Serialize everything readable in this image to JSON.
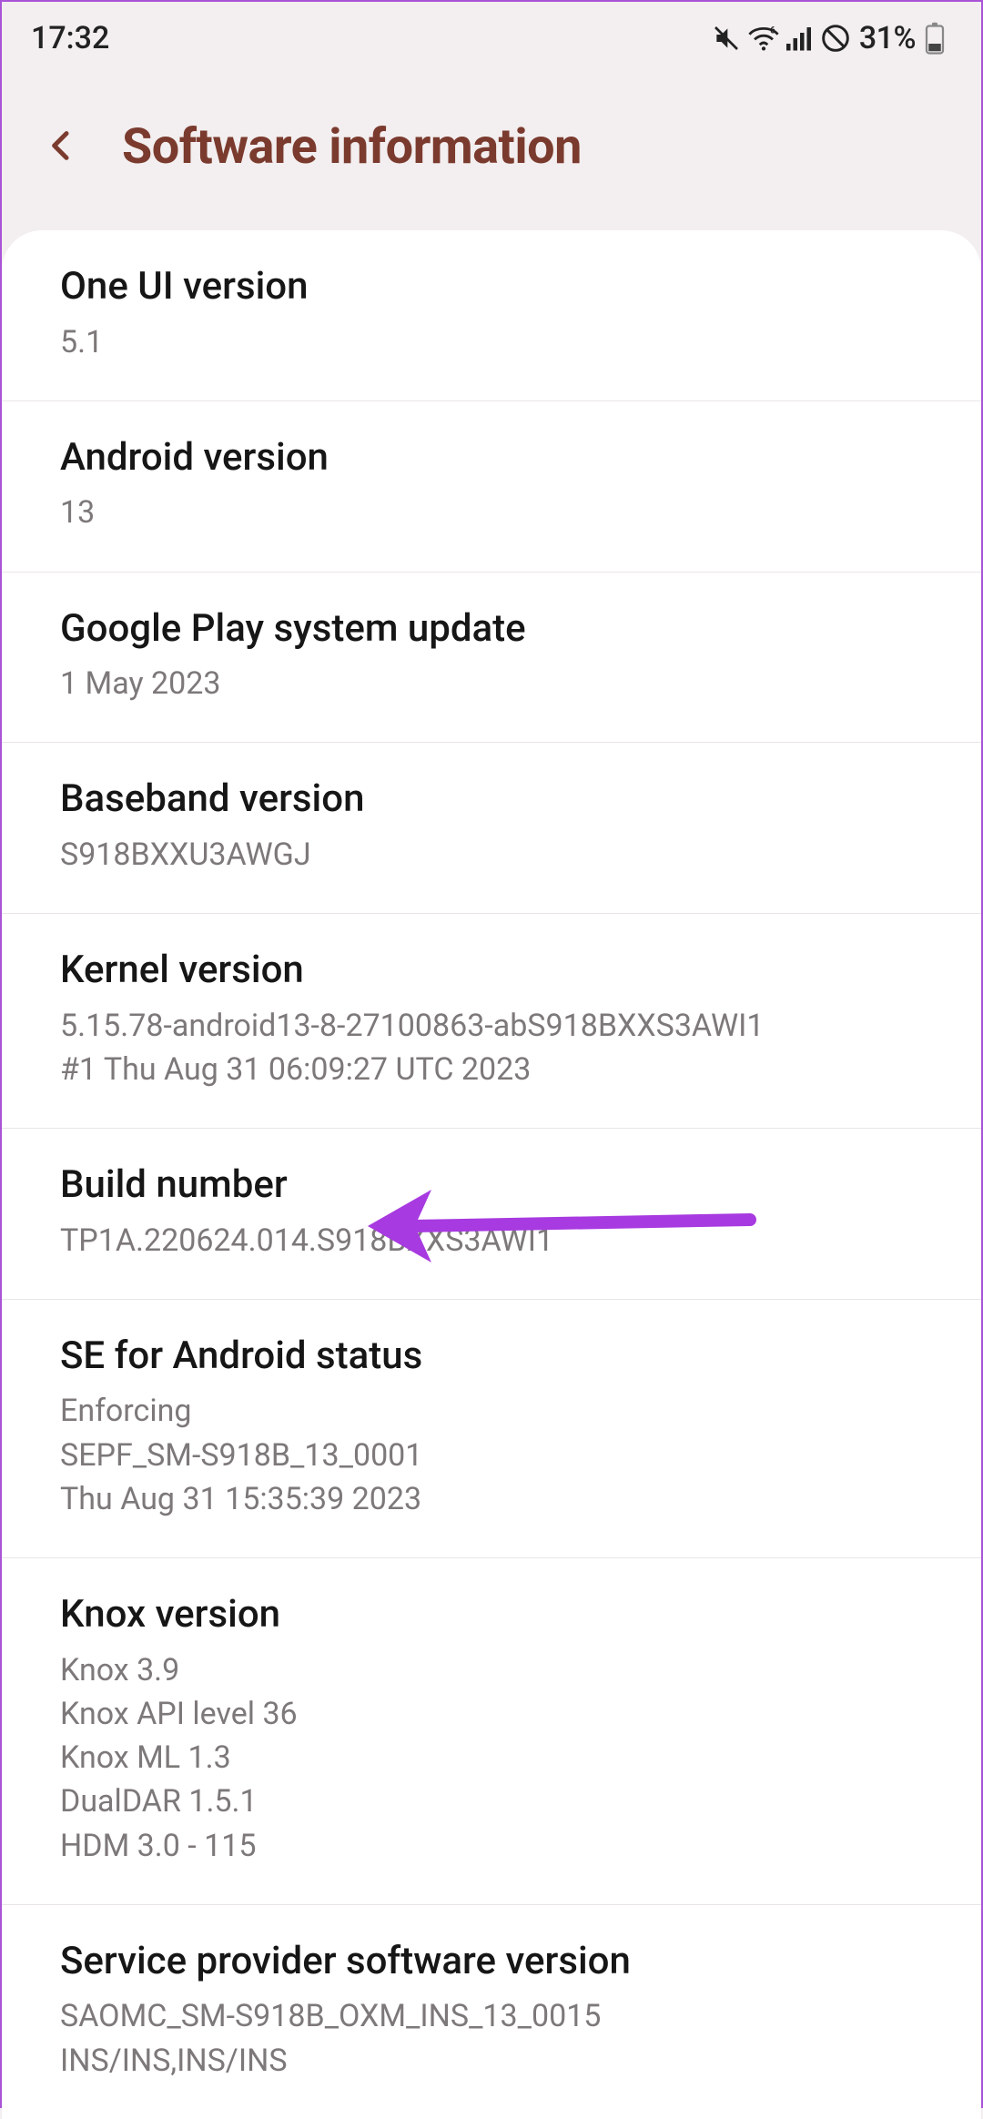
{
  "status": {
    "time": "17:32",
    "battery_text": "31%"
  },
  "header": {
    "title": "Software information"
  },
  "rows": {
    "oneui": {
      "title": "One UI version",
      "value": "5.1"
    },
    "android": {
      "title": "Android version",
      "value": "13"
    },
    "play": {
      "title": "Google Play system update",
      "value": "1 May 2023"
    },
    "baseband": {
      "title": "Baseband version",
      "value": "S918BXXU3AWGJ"
    },
    "kernel": {
      "title": "Kernel version",
      "value": "5.15.78-android13-8-27100863-abS918BXXS3AWI1\n#1 Thu Aug 31 06:09:27 UTC 2023"
    },
    "build": {
      "title": "Build number",
      "value": "TP1A.220624.014.S918BXXS3AWI1"
    },
    "se": {
      "title": "SE for Android status",
      "value": "Enforcing\nSEPF_SM-S918B_13_0001\nThu Aug 31 15:35:39 2023"
    },
    "knox": {
      "title": "Knox version",
      "value": "Knox 3.9\nKnox API level 36\nKnox ML 1.3\nDualDAR 1.5.1\nHDM 3.0 - 115"
    },
    "provider": {
      "title": "Service provider software version",
      "value": "SAOMC_SM-S918B_OXM_INS_13_0015\nINS/INS,INS/INS"
    }
  },
  "colors": {
    "accent": "#7a3b2e",
    "background": "#f3eeef",
    "divider": "#e9e5e6",
    "subtext": "#7d7879",
    "arrow": "#a73ae0"
  }
}
